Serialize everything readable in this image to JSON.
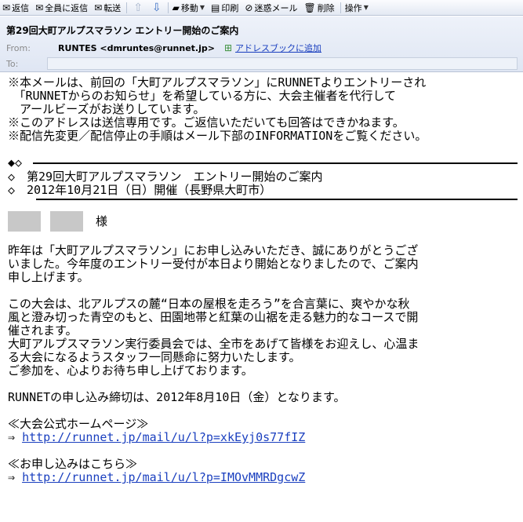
{
  "toolbar": {
    "reply": "返信",
    "reply_all": "全員に返信",
    "forward": "転送",
    "move": "移動",
    "print": "印刷",
    "spam": "迷惑メール",
    "delete": "削除",
    "actions": "操作"
  },
  "header": {
    "subject": "第29回大町アルプスマラソン エントリー開始のご案内",
    "from_label": "From:",
    "from_sender": "RUNTES <dmruntes@runnet.jp>",
    "add_address_book": "アドレスブックに追加",
    "to_label": "To:"
  },
  "body": {
    "notice": [
      "※本メールは、前回の「大町アルプスマラソン」にRUNNETよりエントリーされ",
      "　「RUNNETからのお知らせ」を希望している方に、大会主催者を代行して",
      "　アールビーズがお送りしています。",
      "※このアドレスは送信専用です。ご返信いただいても回答はできかねます。",
      "※配信先変更／配信停止の手順はメール下部のINFORMATIONをご覧ください。"
    ],
    "box_head": "◆◇",
    "box_title": "◇　第29回大町アルプスマラソン　エントリー開始のご案内",
    "box_date": "◇　2012年10月21日（日）開催（長野県大町市）",
    "salutation": "様",
    "para1": [
      "昨年は「大町アルプスマラソン」にお申し込みいただき、誠にありがとうござ",
      "いました。今年度のエントリー受付が本日より開始となりましたので、ご案内",
      "申し上げます。"
    ],
    "para2": [
      "この大会は、北アルプスの麓“日本の屋根を走ろう”を合言葉に、爽やかな秋",
      "風と澄み切った青空のもと、田園地帯と紅葉の山裾を走る魅力的なコースで開",
      "催されます。",
      "大町アルプスマラソン実行委員会では、全市をあげて皆様をお迎えし、心温ま",
      "る大会になるようスタッフ一同懸命に努力いたします。",
      "ご参加を、心よりお待ち申し上げております。"
    ],
    "deadline": "RUNNETの申し込み締切は、2012年8月10日（金）となります。",
    "official_label": "≪大会公式ホームページ≫",
    "arrow": "⇒",
    "official_url": "http://runnet.jp/mail/u/l?p=xkEyj0s77fIZ",
    "apply_label": "≪お申し込みはこちら≫",
    "apply_url": "http://runnet.jp/mail/u/l?p=IMOvMMRDgcwZ"
  }
}
